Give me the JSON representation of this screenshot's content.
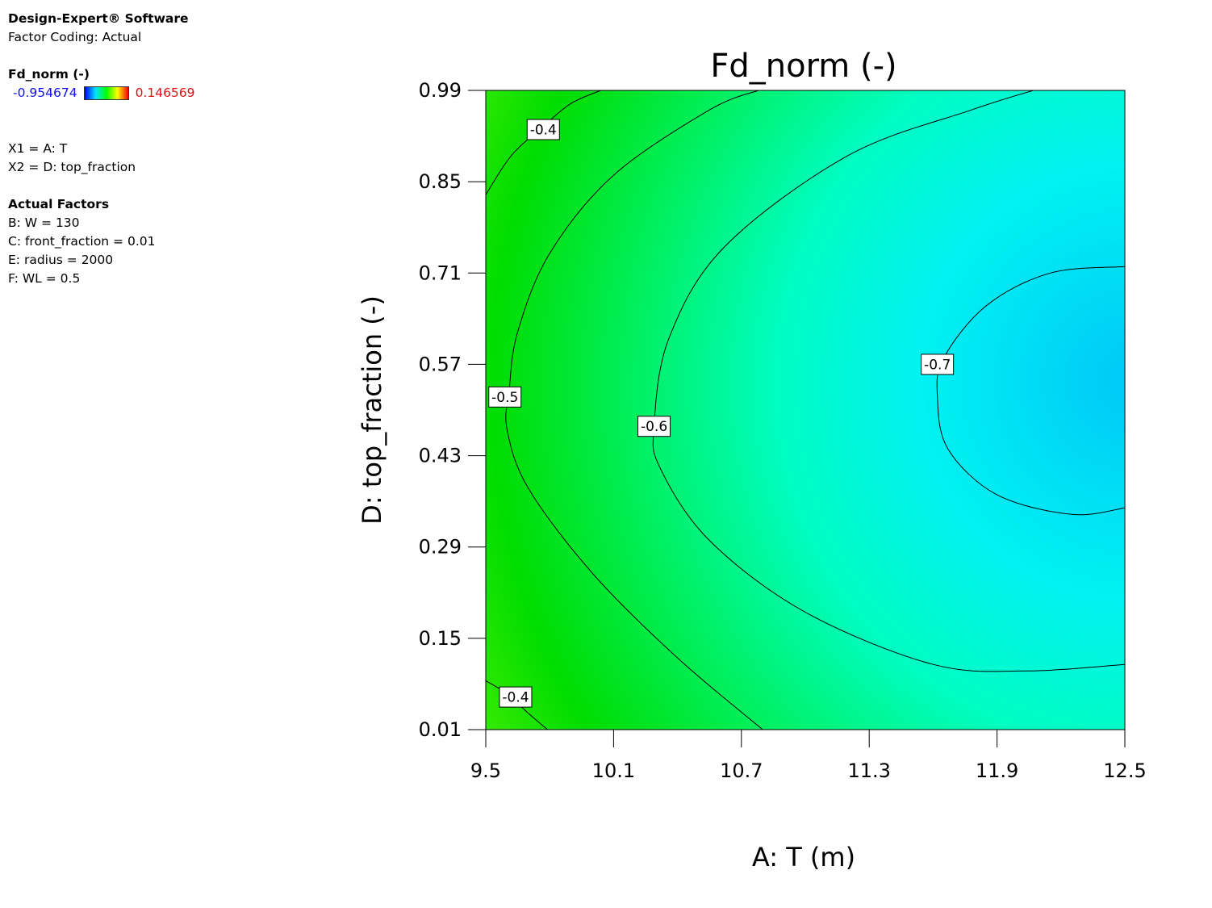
{
  "sidebar": {
    "software": "Design-Expert® Software",
    "coding": "Factor Coding: Actual",
    "response": "Fd_norm (-)",
    "legend_min": "-0.954674",
    "legend_max": "0.146569",
    "x1": "X1 = A: T",
    "x2": "X2 = D: top_fraction",
    "actual_factors_title": "Actual Factors",
    "actual_factors": [
      "B: W = 130",
      "C: front_fraction = 0.01",
      "E: radius = 2000",
      "F: WL = 0.5"
    ]
  },
  "colors": {
    "low": "#0000ff",
    "mid_low": "#00e5ff",
    "mid": "#00ff00",
    "mid_high": "#ffff00",
    "high": "#ff0000"
  },
  "chart_data": {
    "type": "contour",
    "title": "Fd_norm (-)",
    "xlabel": "A: T (m)",
    "ylabel": "D: top_fraction (-)",
    "xlim": [
      9.5,
      12.5
    ],
    "ylim": [
      0.01,
      0.99
    ],
    "xticks": [
      "9.5",
      "10.1",
      "10.7",
      "11.3",
      "11.9",
      "12.5"
    ],
    "yticks": [
      "0.01",
      "0.15",
      "0.29",
      "0.43",
      "0.57",
      "0.71",
      "0.85",
      "0.99"
    ],
    "color_range": [
      -0.954674,
      0.146569
    ],
    "minimum_location": {
      "x": 12.5,
      "y": 0.5,
      "value": -0.83
    },
    "contours": [
      {
        "level": "-0.4",
        "label_at": {
          "x": 9.77,
          "y": 0.93
        },
        "points": [
          [
            9.5,
            0.83
          ],
          [
            9.62,
            0.89
          ],
          [
            9.77,
            0.935
          ],
          [
            9.9,
            0.97
          ],
          [
            10.04,
            0.99
          ]
        ]
      },
      {
        "level": "-0.4",
        "label_at": {
          "x": 9.64,
          "y": 0.06
        },
        "points": [
          [
            9.5,
            0.085
          ],
          [
            9.6,
            0.065
          ],
          [
            9.7,
            0.035
          ],
          [
            9.79,
            0.01
          ]
        ]
      },
      {
        "level": "-0.5",
        "label_at": {
          "x": 9.59,
          "y": 0.52
        },
        "points": [
          [
            10.8,
            0.01
          ],
          [
            10.4,
            0.12
          ],
          [
            10.0,
            0.25
          ],
          [
            9.7,
            0.38
          ],
          [
            9.6,
            0.47
          ],
          [
            9.61,
            0.53
          ],
          [
            9.65,
            0.62
          ],
          [
            9.8,
            0.74
          ],
          [
            10.1,
            0.86
          ],
          [
            10.55,
            0.96
          ],
          [
            10.78,
            0.99
          ]
        ]
      },
      {
        "level": "-0.6",
        "label_at": {
          "x": 10.29,
          "y": 0.475
        },
        "points": [
          [
            12.5,
            0.11
          ],
          [
            12.04,
            0.1
          ],
          [
            11.6,
            0.11
          ],
          [
            11.0,
            0.19
          ],
          [
            10.55,
            0.3
          ],
          [
            10.32,
            0.41
          ],
          [
            10.29,
            0.475
          ],
          [
            10.36,
            0.61
          ],
          [
            10.62,
            0.75
          ],
          [
            11.2,
            0.89
          ],
          [
            11.78,
            0.96
          ],
          [
            12.07,
            0.99
          ]
        ]
      },
      {
        "level": "-0.7",
        "label_at": {
          "x": 11.62,
          "y": 0.57
        },
        "points": [
          [
            12.5,
            0.35
          ],
          [
            12.25,
            0.34
          ],
          [
            11.9,
            0.37
          ],
          [
            11.67,
            0.44
          ],
          [
            11.62,
            0.52
          ],
          [
            11.65,
            0.58
          ],
          [
            11.85,
            0.66
          ],
          [
            12.15,
            0.71
          ],
          [
            12.5,
            0.72
          ]
        ]
      }
    ]
  }
}
